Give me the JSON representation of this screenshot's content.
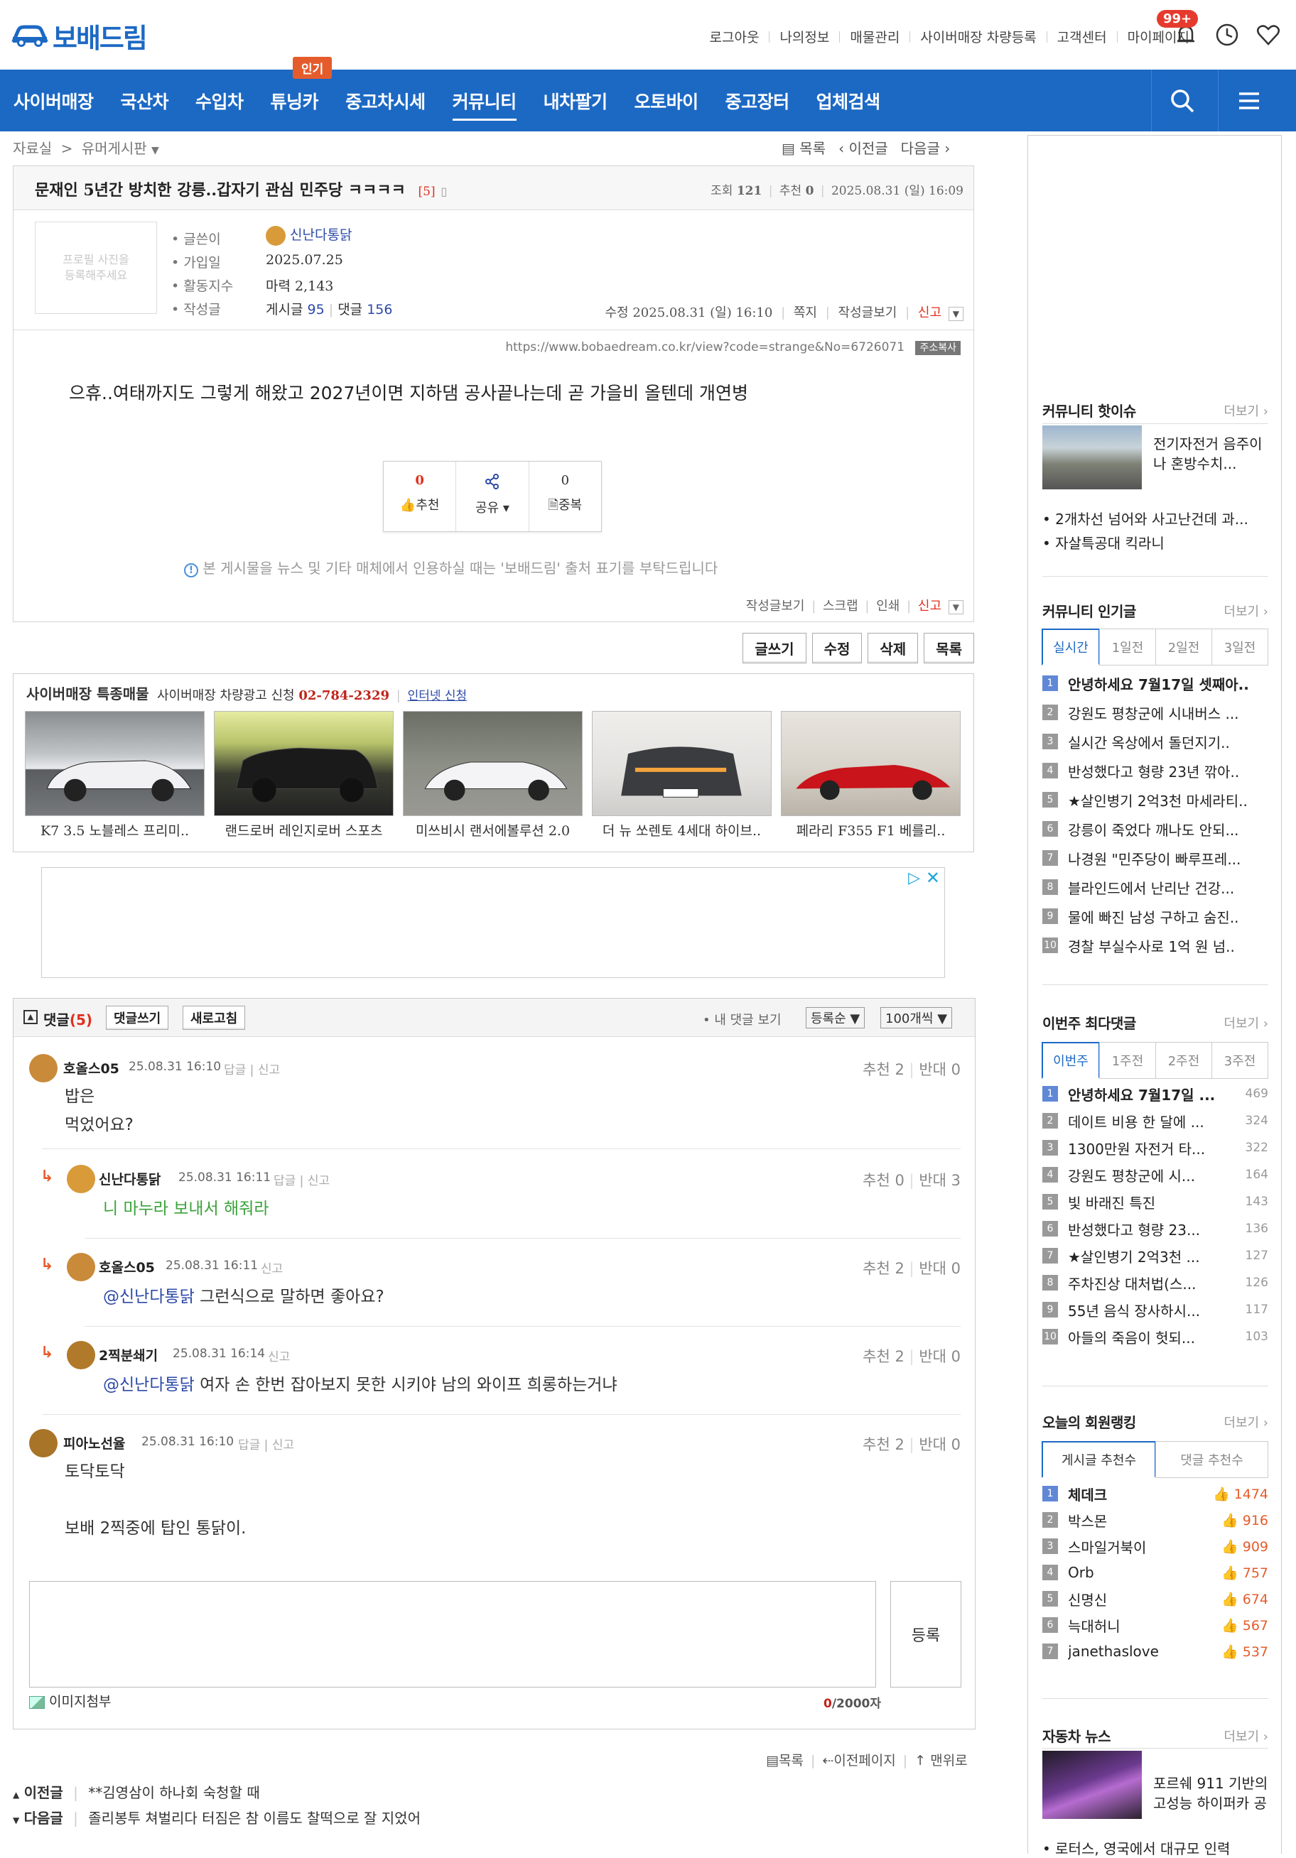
{
  "header": {
    "logo": "보배드림",
    "links": [
      "로그아웃",
      "나의정보",
      "매물관리",
      "사이버매장 차량등록",
      "고객센터",
      "마이페이지"
    ],
    "notif_badge": "99+"
  },
  "nav": {
    "items": [
      "사이버매장",
      "국산차",
      "수입차",
      "튜닝카",
      "중고차시세",
      "커뮤니티",
      "내차팔기",
      "오토바이",
      "중고장터",
      "업체검색"
    ],
    "hot_badge": "인기"
  },
  "breadcrumb": {
    "a": "자료실",
    "b": "유머게시판"
  },
  "post_nav": {
    "list": "목록",
    "prev": "이전글",
    "next": "다음글"
  },
  "post": {
    "title": "문재인 5년간 방치한 강릉..갑자기 관심 민주당 ㅋㅋㅋㅋ",
    "comment_count": "[5]",
    "views_label": "조회",
    "views": "121",
    "rec_label": "추천",
    "rec": "0",
    "date": "2025.08.31 (일) 16:09",
    "profile_placeholder_1": "프로필 사진을",
    "profile_placeholder_2": "등록해주세요",
    "info": {
      "writer_label": "글쓴이",
      "writer": "신난다통닭",
      "joined_label": "가입일",
      "joined": "2025.07.25",
      "activity_label": "활동지수",
      "activity": "마력 2,143",
      "posts_label": "작성글",
      "posts_text": "게시글",
      "posts": "95",
      "comments_text": "댓글",
      "comments": "156"
    },
    "edit_line": "수정 2025.08.31 (일) 16:10",
    "edit_links": [
      "쪽지",
      "작성글보기"
    ],
    "report": "신고",
    "url": "https://www.bobaedream.co.kr/view?code=strange&No=6726071",
    "url_copy": "주소복사",
    "body": "으휴..여태까지도 그렇게 해왔고 2027년이면 지하댐 공사끝나는데 곧 가을비 올텐데 개연병",
    "reactions": [
      {
        "count": "0",
        "label": "추천"
      },
      {
        "count": "",
        "label": "공유"
      },
      {
        "count": "0",
        "label": "중복"
      }
    ],
    "notice": "본 게시물을 뉴스 및 기타 매체에서 인용하실 때는 '보배드림' 출처 표기를 부탁드립니다",
    "foot_links": [
      "작성글보기",
      "스크랩",
      "인쇄"
    ]
  },
  "buttons": [
    "글쓰기",
    "수정",
    "삭제",
    "목록"
  ],
  "cyber": {
    "title": "사이버매장 특종매물",
    "ad_text": "사이버매장 차량광고 신청",
    "phone": "02-784-2329",
    "apply": "인터넷 신청",
    "cars": [
      "K7 3.5 노블레스 프리미..",
      "랜드로버 레인지로버 스포츠",
      "미쓰비시 랜서에볼루션 2.0",
      "더 뉴 쏘렌토 4세대 하이브..",
      "페라리 F355 F1 베를리.."
    ]
  },
  "comments_section": {
    "label": "댓글",
    "count": "(5)",
    "write": "댓글쓰기",
    "refresh": "새로고침",
    "my_comments": "내 댓글 보기",
    "sort": "등록순",
    "per_page": "100개씩"
  },
  "comments": [
    {
      "name": "호올스05",
      "date": "25.08.31 16:10",
      "links": "답글 | 신고",
      "up": "추천 2",
      "down": "반대 0",
      "lines": [
        "밥은",
        "먹었어요?"
      ]
    },
    {
      "name": "신난다통닭",
      "date": "25.08.31 16:11",
      "links": "답글 | 신고",
      "up": "추천 0",
      "down": "반대 3",
      "text": "니 마누라 보내서 해줘라"
    },
    {
      "name": "호올스05",
      "date": "25.08.31 16:11",
      "links": "신고",
      "up": "추천 2",
      "down": "반대 0",
      "mention": "@신난다통닭",
      "text": " 그런식으로 말하면 좋아요?"
    },
    {
      "name": "2찍분쇄기",
      "date": "25.08.31 16:14",
      "links": "신고",
      "up": "추천 2",
      "down": "반대 0",
      "mention": "@신난다통닭",
      "text": " 여자 손 한번 잡아보지 못한 시키야 남의 와이프 희롱하는거냐"
    },
    {
      "name": "피아노선율",
      "date": "25.08.31 16:10",
      "links": "답글 | 신고",
      "up": "추천 2",
      "down": "반대 0",
      "lines": [
        "토닥토닥",
        "",
        "보배 2찍중에 탑인 통닭이."
      ]
    }
  ],
  "comment_form": {
    "submit": "등록",
    "image": "이미지첨부",
    "count": "0",
    "max": "/2000자"
  },
  "bottom": {
    "links": [
      "목록",
      "이전페이지",
      "맨위로"
    ],
    "prev_label": "이전글",
    "prev_title": "**김영삼이 하나회 숙청할 때",
    "next_label": "다음글",
    "next_title": "졸리봉투 쳐벌리다 터짐은 참 이름도 찰떡으로 잘 지었어"
  },
  "sidebar": {
    "more": "더보기",
    "hot": {
      "title": "커뮤니티 핫이슈",
      "feature": "전기자전거 음주이나 혼방수치...",
      "items": [
        "2개차선 넘어와 사고난건데 과...",
        "자살특공대 킥라니"
      ]
    },
    "popular": {
      "title": "커뮤니티 인기글",
      "tabs": [
        "실시간",
        "1일전",
        "2일전",
        "3일전"
      ],
      "items": [
        "안녕하세요 7월17일 셋째아..",
        "강원도 평창군에 시내버스 ...",
        "실시간 옥상에서 돌던지기..",
        "반성했다고 형량 23년 깎아..",
        "★살인병기 2억3천 마세라티..",
        "강릉이 죽었다 깨나도 안되...",
        "나경원 \"민주당이 빠루프레...",
        "블라인드에서 난리난 건강...",
        "물에 빠진 남성 구하고 숨진..",
        "경찰 부실수사로 1억 원 넘.."
      ]
    },
    "weekly": {
      "title": "이번주 최다댓글",
      "tabs": [
        "이번주",
        "1주전",
        "2주전",
        "3주전"
      ],
      "items": [
        {
          "t": "안녕하세요 7월17일 ...",
          "c": "469"
        },
        {
          "t": "데이트 비용 한 달에 ...",
          "c": "324"
        },
        {
          "t": "1300만원 자전거 타...",
          "c": "322"
        },
        {
          "t": "강원도 평창군에 시...",
          "c": "164"
        },
        {
          "t": "빛 바래진 특진",
          "c": "143"
        },
        {
          "t": "반성했다고 형량 23...",
          "c": "136"
        },
        {
          "t": "★살인병기 2억3천 ...",
          "c": "127"
        },
        {
          "t": "주차진상 대처법(스...",
          "c": "126"
        },
        {
          "t": "55년 음식 장사하시...",
          "c": "117"
        },
        {
          "t": "아들의 죽음이 헛되...",
          "c": "103"
        }
      ]
    },
    "members": {
      "title": "오늘의 회원랭킹",
      "tabs": [
        "게시글 추천수",
        "댓글 추천수"
      ],
      "items": [
        {
          "t": "체데크",
          "c": "1474"
        },
        {
          "t": "박스몬",
          "c": "916"
        },
        {
          "t": "스마일거북이",
          "c": "909"
        },
        {
          "t": "Orb",
          "c": "757"
        },
        {
          "t": "신명신",
          "c": "674"
        },
        {
          "t": "늑대허니",
          "c": "567"
        },
        {
          "t": "janethaslove",
          "c": "537"
        }
      ]
    },
    "news": {
      "title": "자동차 뉴스",
      "feature": "포르쉐 911 기반의 고성능 하이퍼카 공",
      "item": "로터스, 영국에서 대규모 인력"
    }
  }
}
